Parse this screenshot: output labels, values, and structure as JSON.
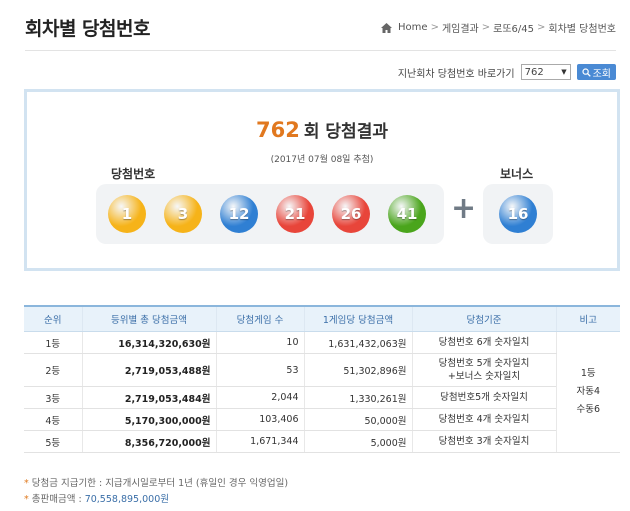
{
  "header": {
    "title": "회차별 당첨번호",
    "breadcrumb": [
      "Home",
      "게임결과",
      "로또6/45",
      "회차별 당첨번호"
    ]
  },
  "round_select": {
    "label": "지난회차 당첨번호 바로가기",
    "selected": "762",
    "search_label": "조회"
  },
  "result": {
    "draw_no": "762",
    "title_suffix": "회 당첨결과",
    "date": "(2017년 07월 08일 추첨)",
    "win_label": "당첨번호",
    "bonus_label": "보너스",
    "plus": "+",
    "numbers": [
      "1",
      "3",
      "12",
      "21",
      "26",
      "41"
    ],
    "bonus": "16",
    "ball_colors": {
      "yellow": "#f6b319",
      "blue": "#2f7fd3",
      "red": "#e8453a",
      "green": "#4aa51c"
    }
  },
  "table": {
    "headers": [
      "순위",
      "등위별 총 당첨금액",
      "당첨게임 수",
      "1게임당 당첨금액",
      "당첨기준",
      "비고"
    ],
    "rows": [
      {
        "rank": "1등",
        "total": "16,314,320,630원",
        "count": "10",
        "per": "1,631,432,063원",
        "crit1": "당첨번호 6개 숫자일치",
        "crit2": ""
      },
      {
        "rank": "2등",
        "total": "2,719,053,488원",
        "count": "53",
        "per": "51,302,896원",
        "crit1": "당첨번호 5개 숫자일치",
        "crit2": "+보너스 숫자일치"
      },
      {
        "rank": "3등",
        "total": "2,719,053,484원",
        "count": "2,044",
        "per": "1,330,261원",
        "crit1": "당첨번호5개 숫자일치",
        "crit2": ""
      },
      {
        "rank": "4등",
        "total": "5,170,300,000원",
        "count": "103,406",
        "per": "50,000원",
        "crit1": "당첨번호 4개 숫자일치",
        "crit2": ""
      },
      {
        "rank": "5등",
        "total": "8,356,720,000원",
        "count": "1,671,344",
        "per": "5,000원",
        "crit1": "당첨번호 3개 숫자일치",
        "crit2": ""
      }
    ],
    "note": [
      "1등",
      "자동4",
      "수동6"
    ]
  },
  "notes": {
    "payout": "당첨금 지급기한 : 지급개시일로부터 1년 (휴일인 경우 익영업일)",
    "sales_label": "총판매금액 :",
    "sales_amount": "70,558,895,000원"
  }
}
